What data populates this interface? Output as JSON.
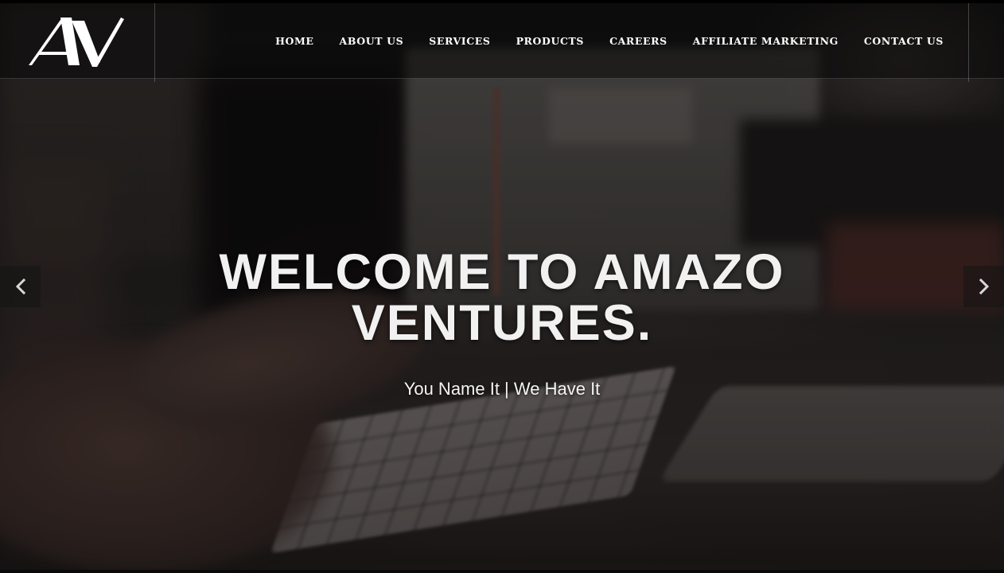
{
  "brand": {
    "logo_text": "AV"
  },
  "nav": {
    "items": [
      {
        "label": "HOME"
      },
      {
        "label": "ABOUT US"
      },
      {
        "label": "SERVICES"
      },
      {
        "label": "PRODUCTS"
      },
      {
        "label": "CAREERS"
      },
      {
        "label": "AFFILIATE MARKETING"
      },
      {
        "label": "CONTACT US"
      }
    ]
  },
  "hero": {
    "title_line1": "WELCOME TO AMAZO",
    "title_line2": "VENTURES.",
    "subtitle": "You Name It | We Have It"
  },
  "carousel": {
    "prev_icon": "chevron-left-icon",
    "next_icon": "chevron-right-icon"
  },
  "colors": {
    "text": "#ffffff",
    "header_bg": "#080808"
  }
}
